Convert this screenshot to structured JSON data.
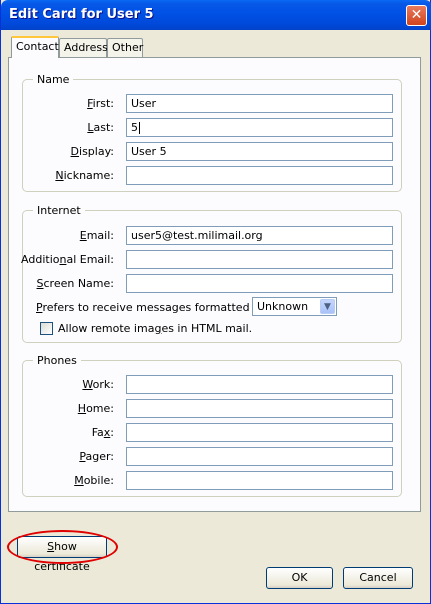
{
  "window": {
    "title": "Edit Card for User 5",
    "close_glyph": "✕"
  },
  "tabs": [
    "Contact",
    "Address",
    "Other"
  ],
  "name_group": {
    "legend": "Name",
    "fields": [
      {
        "label": "First:",
        "value": "User"
      },
      {
        "label": "Last:",
        "value": "5"
      },
      {
        "label": "Display:",
        "value": "User 5"
      },
      {
        "label": "Nickname:",
        "value": ""
      }
    ]
  },
  "internet_group": {
    "legend": "Internet",
    "fields": [
      {
        "label": "Email:",
        "value": "user5@test.milimail.org"
      },
      {
        "label": "Additional Email:",
        "value": ""
      },
      {
        "label": "Screen Name:",
        "value": ""
      }
    ],
    "format_label": "Prefers to receive messages formatted as:",
    "format_value": "Unknown",
    "remote_images_label": "Allow remote images in HTML mail."
  },
  "phones_group": {
    "legend": "Phones",
    "fields": [
      {
        "label": "Work:",
        "value": ""
      },
      {
        "label": "Home:",
        "value": ""
      },
      {
        "label": "Fax:",
        "value": ""
      },
      {
        "label": "Pager:",
        "value": ""
      },
      {
        "label": "Mobile:",
        "value": ""
      }
    ]
  },
  "buttons": {
    "show_certificate": "Show certificate",
    "ok": "OK",
    "cancel": "Cancel"
  }
}
